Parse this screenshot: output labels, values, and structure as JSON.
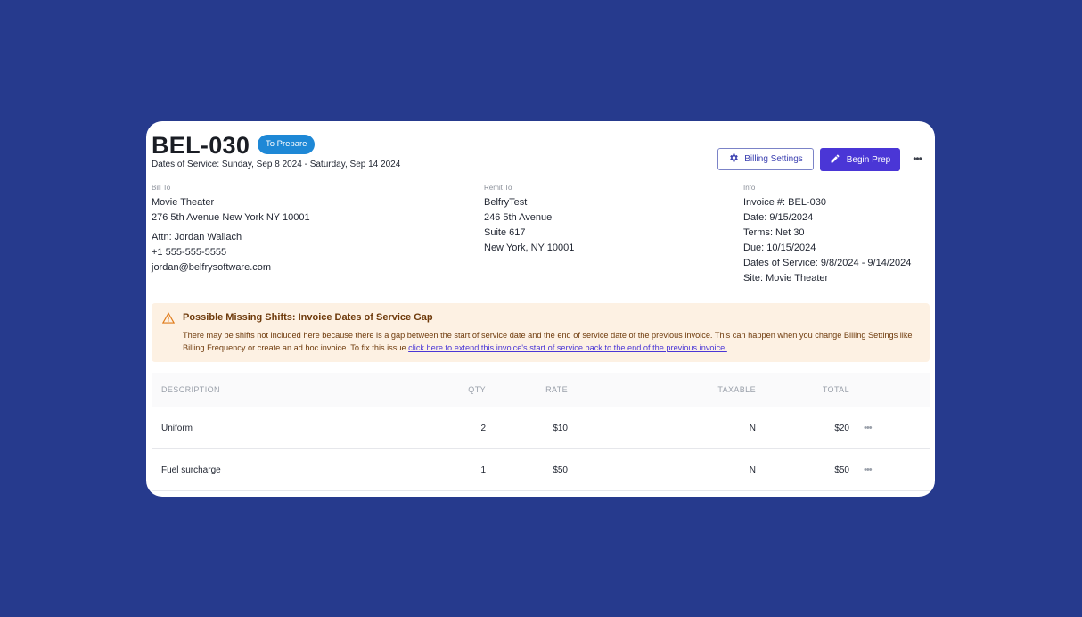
{
  "invoice": {
    "title": "BEL-030",
    "status": "To Prepare",
    "dates_of_service_line": "Dates of Service: Sunday, Sep 8 2024 - Saturday, Sep 14 2024"
  },
  "actions": {
    "billing_settings_label": "Billing Settings",
    "begin_prep_label": "Begin Prep",
    "more_label": "•••"
  },
  "bill_to": {
    "label": "Bill To",
    "name": "Movie Theater",
    "address": "276 5th Avenue New York NY 10001",
    "attn": "Attn: Jordan Wallach",
    "phone": "+1 555-555-5555",
    "email": "jordan@belfrysoftware.com"
  },
  "remit_to": {
    "label": "Remit To",
    "name": "BelfryTest",
    "line1": "246 5th Avenue",
    "line2": "Suite 617",
    "line3": "New York, NY 10001"
  },
  "info": {
    "label": "Info",
    "invoice_number": "Invoice #: BEL-030",
    "date": "Date: 9/15/2024",
    "terms": "Terms: Net 30",
    "due": "Due: 10/15/2024",
    "dates_of_service": "Dates of Service: 9/8/2024 - 9/14/2024",
    "site": "Site: Movie Theater"
  },
  "alert": {
    "title": "Possible Missing Shifts: Invoice Dates of Service Gap",
    "body": "There may be shifts not included here because there is a gap between the start of service date and the end of service date of the previous invoice. This can happen when you change Billing Settings like Billing Frequency or create an ad hoc invoice. To fix this issue ",
    "link": "click here to extend this invoice's start of service back to the end of the previous invoice."
  },
  "table": {
    "headers": {
      "description": "DESCRIPTION",
      "qty": "QTY",
      "rate": "RATE",
      "taxable": "TAXABLE",
      "total": "TOTAL"
    },
    "rows": [
      {
        "description": "Uniform",
        "qty": "2",
        "rate": "$10",
        "taxable": "N",
        "total": "$20",
        "more": "•••"
      },
      {
        "description": "Fuel surcharge",
        "qty": "1",
        "rate": "$50",
        "taxable": "N",
        "total": "$50",
        "more": "•••"
      }
    ]
  },
  "colors": {
    "background": "#263a8d",
    "status_badge": "#1e88d6",
    "primary_button": "#4a36d6",
    "alert_background": "#fdf1e3",
    "alert_text": "#6e3a0b"
  },
  "icons": {
    "billing_settings": "gear-icon",
    "begin_prep": "pencil-icon",
    "alert": "warning-triangle-icon",
    "more": "more-horizontal-icon"
  }
}
